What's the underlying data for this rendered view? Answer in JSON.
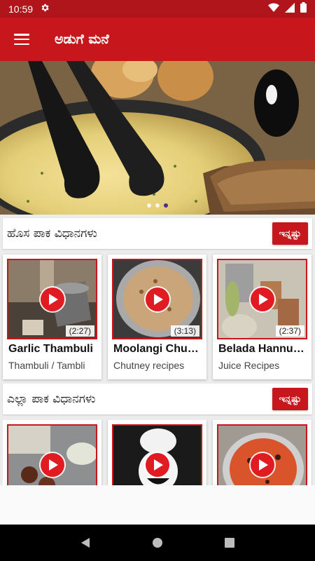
{
  "status_bar": {
    "time": "10:59",
    "settings_icon": "gear-icon",
    "wifi_icon": "wifi-icon",
    "signal_icon": "signal-icon",
    "battery_icon": "battery-icon"
  },
  "app_bar": {
    "title": "ಅಡುಗೆ ಮನೆ",
    "menu_icon": "hamburger-menu-icon"
  },
  "banner": {
    "slide_count": 3,
    "active_slide": 3
  },
  "sections": [
    {
      "title": "ಹೊಸ ಪಾಕ ವಿಧಾನಗಳು",
      "more_label": "ಇನ್ನಷ್ಟು",
      "cards": [
        {
          "title": "Garlic Thambuli",
          "subtitle": "Thambuli / Tambli",
          "duration": "(2:27)"
        },
        {
          "title": "Moolangi Chutney",
          "subtitle": "Chutney recipes",
          "duration": "(3:13)"
        },
        {
          "title": "Belada Hannu Juice",
          "subtitle": "Juice Recipes",
          "duration": "(2:37)"
        }
      ]
    },
    {
      "title": "ಎಲ್ಲಾ ಪಾಕ ವಿಧಾನಗಳು",
      "more_label": "ಇನ್ನಷ್ಟು",
      "cards": [
        {
          "title": "",
          "subtitle": "",
          "duration": ""
        },
        {
          "title": "",
          "subtitle": "",
          "duration": ""
        },
        {
          "title": "",
          "subtitle": "",
          "duration": ""
        }
      ]
    }
  ],
  "nav_bar": {
    "back_icon": "back-triangle-icon",
    "home_icon": "home-circle-icon",
    "recents_icon": "recents-square-icon"
  },
  "colors": {
    "primary": "#c8161d",
    "status_bar": "#b0151b",
    "play": "#e01b22",
    "indicator_active": "#4b2a8c"
  }
}
